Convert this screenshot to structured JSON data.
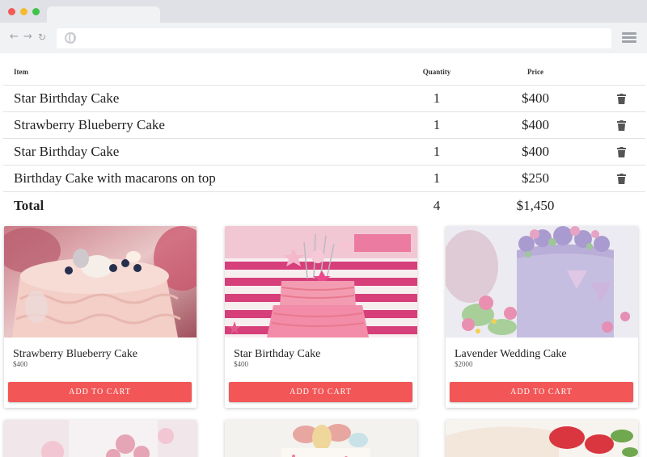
{
  "cart": {
    "headers": {
      "item": "Item",
      "quantity": "Quantity",
      "price": "Price"
    },
    "rows": [
      {
        "item": "Star Birthday Cake",
        "quantity": "1",
        "price": "$400"
      },
      {
        "item": "Strawberry Blueberry Cake",
        "quantity": "1",
        "price": "$400"
      },
      {
        "item": "Star Birthday Cake",
        "quantity": "1",
        "price": "$400"
      },
      {
        "item": "Birthday Cake with macarons on top",
        "quantity": "1",
        "price": "$250"
      }
    ],
    "total": {
      "label": "Total",
      "quantity": "4",
      "price": "$1,450"
    },
    "delete_icon": "trash-icon"
  },
  "products": [
    {
      "name": "Strawberry Blueberry Cake",
      "price": "$400",
      "button": "ADD TO CART"
    },
    {
      "name": "Star Birthday Cake",
      "price": "$400",
      "button": "ADD TO CART"
    },
    {
      "name": "Lavender Wedding Cake",
      "price": "$2000",
      "button": "ADD TO CART"
    }
  ],
  "colors": {
    "accent_button": "#f25656",
    "chrome_bg": "#dfe1e6",
    "window_red": "#f25a55",
    "window_yellow": "#f5bb2f",
    "window_green": "#3fc34a"
  },
  "icons": {
    "back": "back-arrow-icon",
    "forward": "forward-arrow-icon",
    "reload": "reload-icon",
    "site": "globe-icon",
    "menu": "hamburger-menu-icon"
  }
}
